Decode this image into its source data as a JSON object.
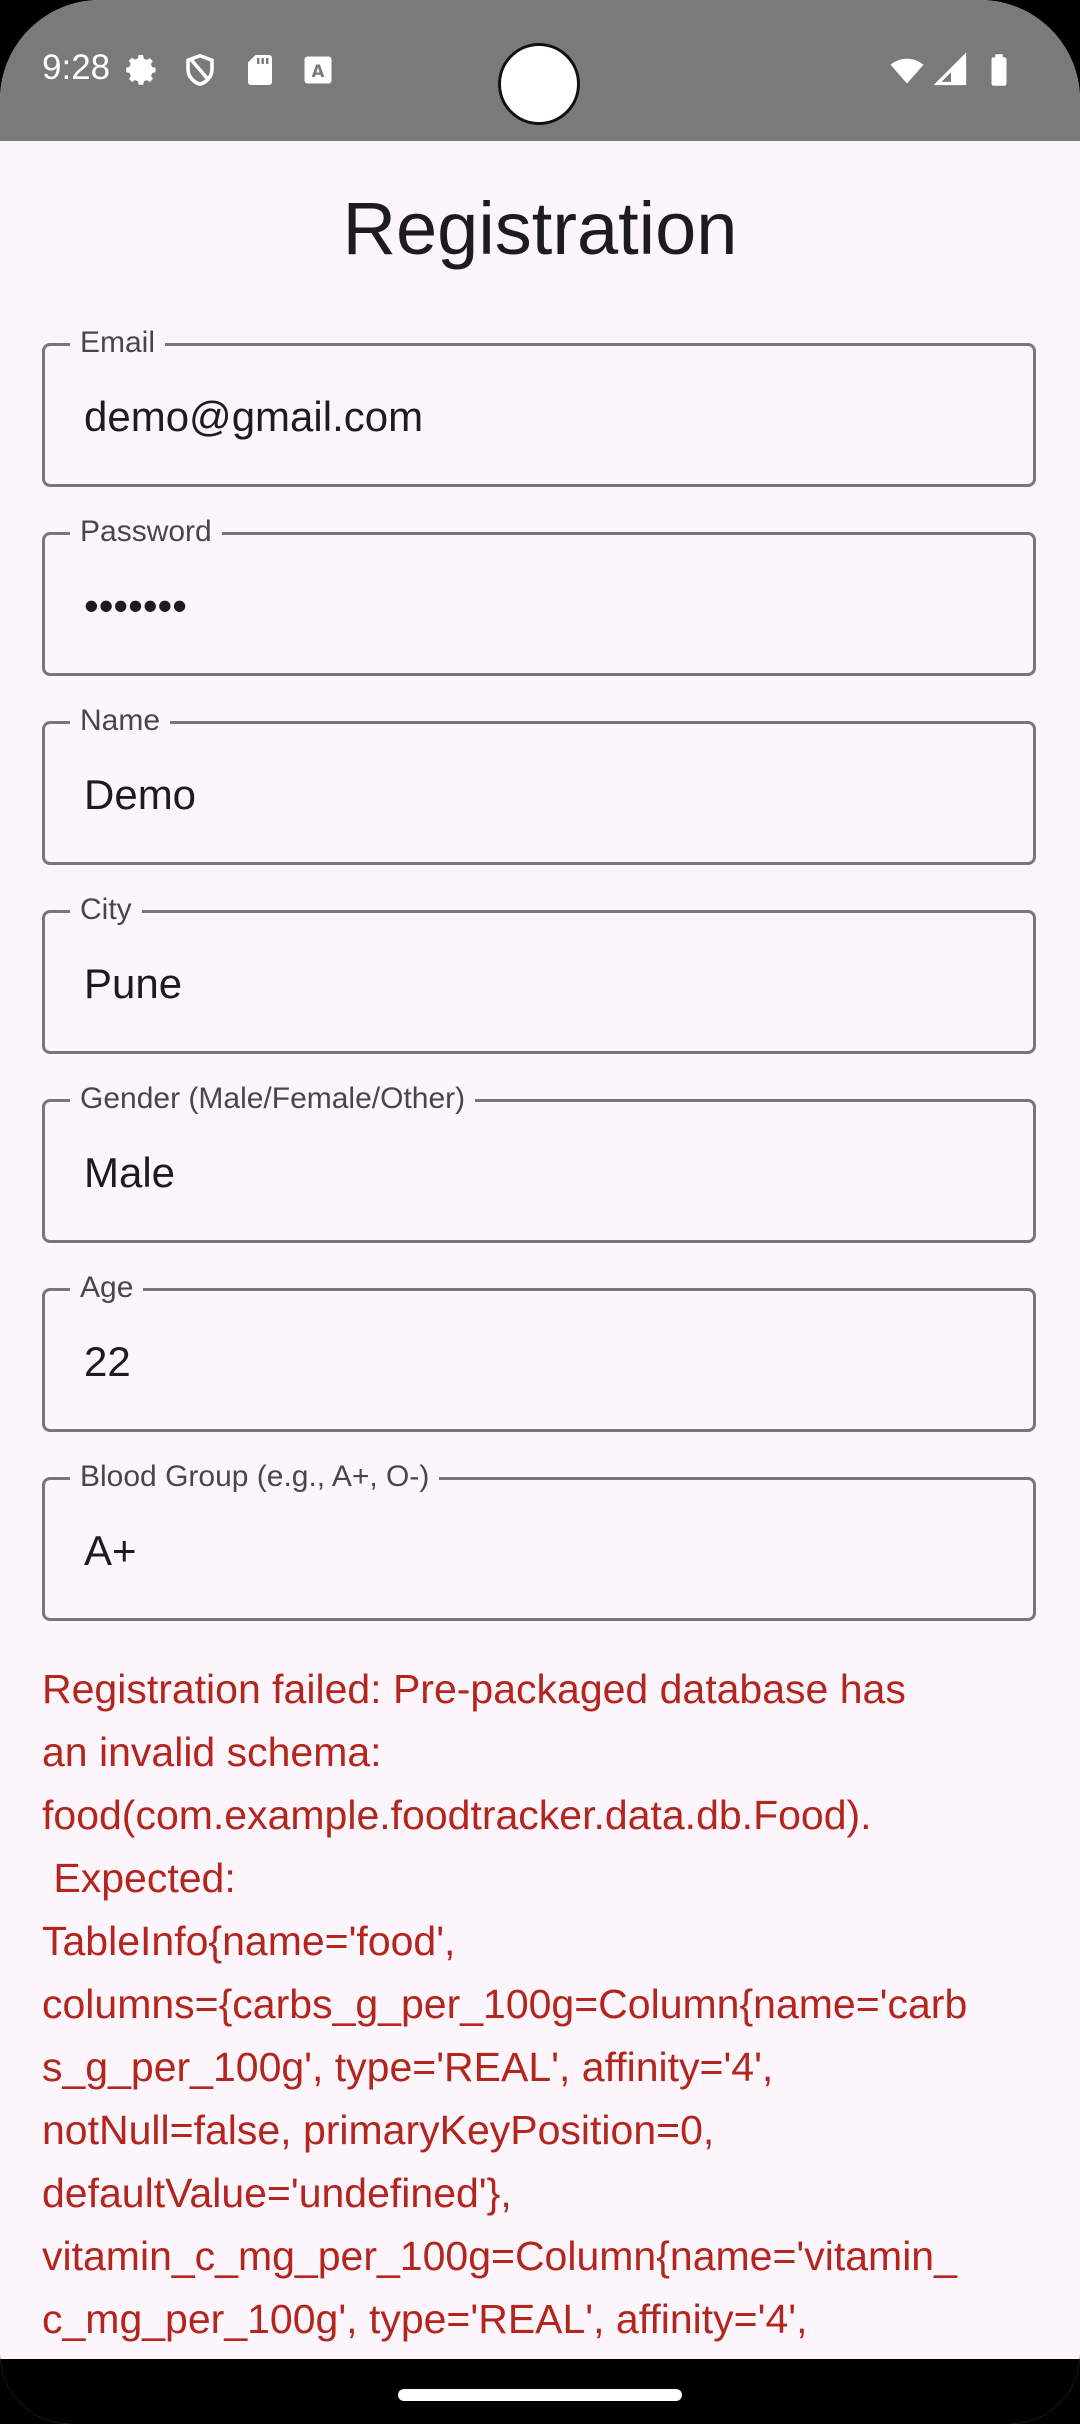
{
  "status_bar": {
    "time": "9:28",
    "left_icons": [
      "gear-icon",
      "shield-icon",
      "sd-card-icon",
      "keyboard-a-icon"
    ],
    "right_icons": [
      "wifi-icon",
      "cell-signal-icon",
      "battery-icon"
    ]
  },
  "page": {
    "title": "Registration"
  },
  "form": {
    "email": {
      "label": "Email",
      "value": "demo@gmail.com"
    },
    "password": {
      "label": "Password",
      "value": "•••••••"
    },
    "name": {
      "label": "Name",
      "value": "Demo"
    },
    "city": {
      "label": "City",
      "value": "Pune"
    },
    "gender": {
      "label": "Gender (Male/Female/Other)",
      "value": "Male"
    },
    "age": {
      "label": "Age",
      "value": "22"
    },
    "blood_group": {
      "label": "Blood Group (e.g., A+, O-)",
      "value": "A+"
    }
  },
  "error": {
    "lines": [
      "Registration failed: Pre-packaged database has",
      "an invalid schema:",
      "food(com.example.foodtracker.data.db.Food).",
      " Expected:",
      "TableInfo{name='food',",
      "columns={carbs_g_per_100g=Column{name='carb",
      "s_g_per_100g', type='REAL', affinity='4',",
      "notNull=false, primaryKeyPosition=0,",
      "defaultValue='undefined'},",
      "vitamin_c_mg_per_100g=Column{name='vitamin_",
      "c_mg_per_100g', type='REAL', affinity='4',"
    ]
  },
  "colors": {
    "status_bar": "#7a7a7a",
    "background": "#fdf5fc",
    "error": "#b3261e",
    "outline": "#79747e"
  }
}
